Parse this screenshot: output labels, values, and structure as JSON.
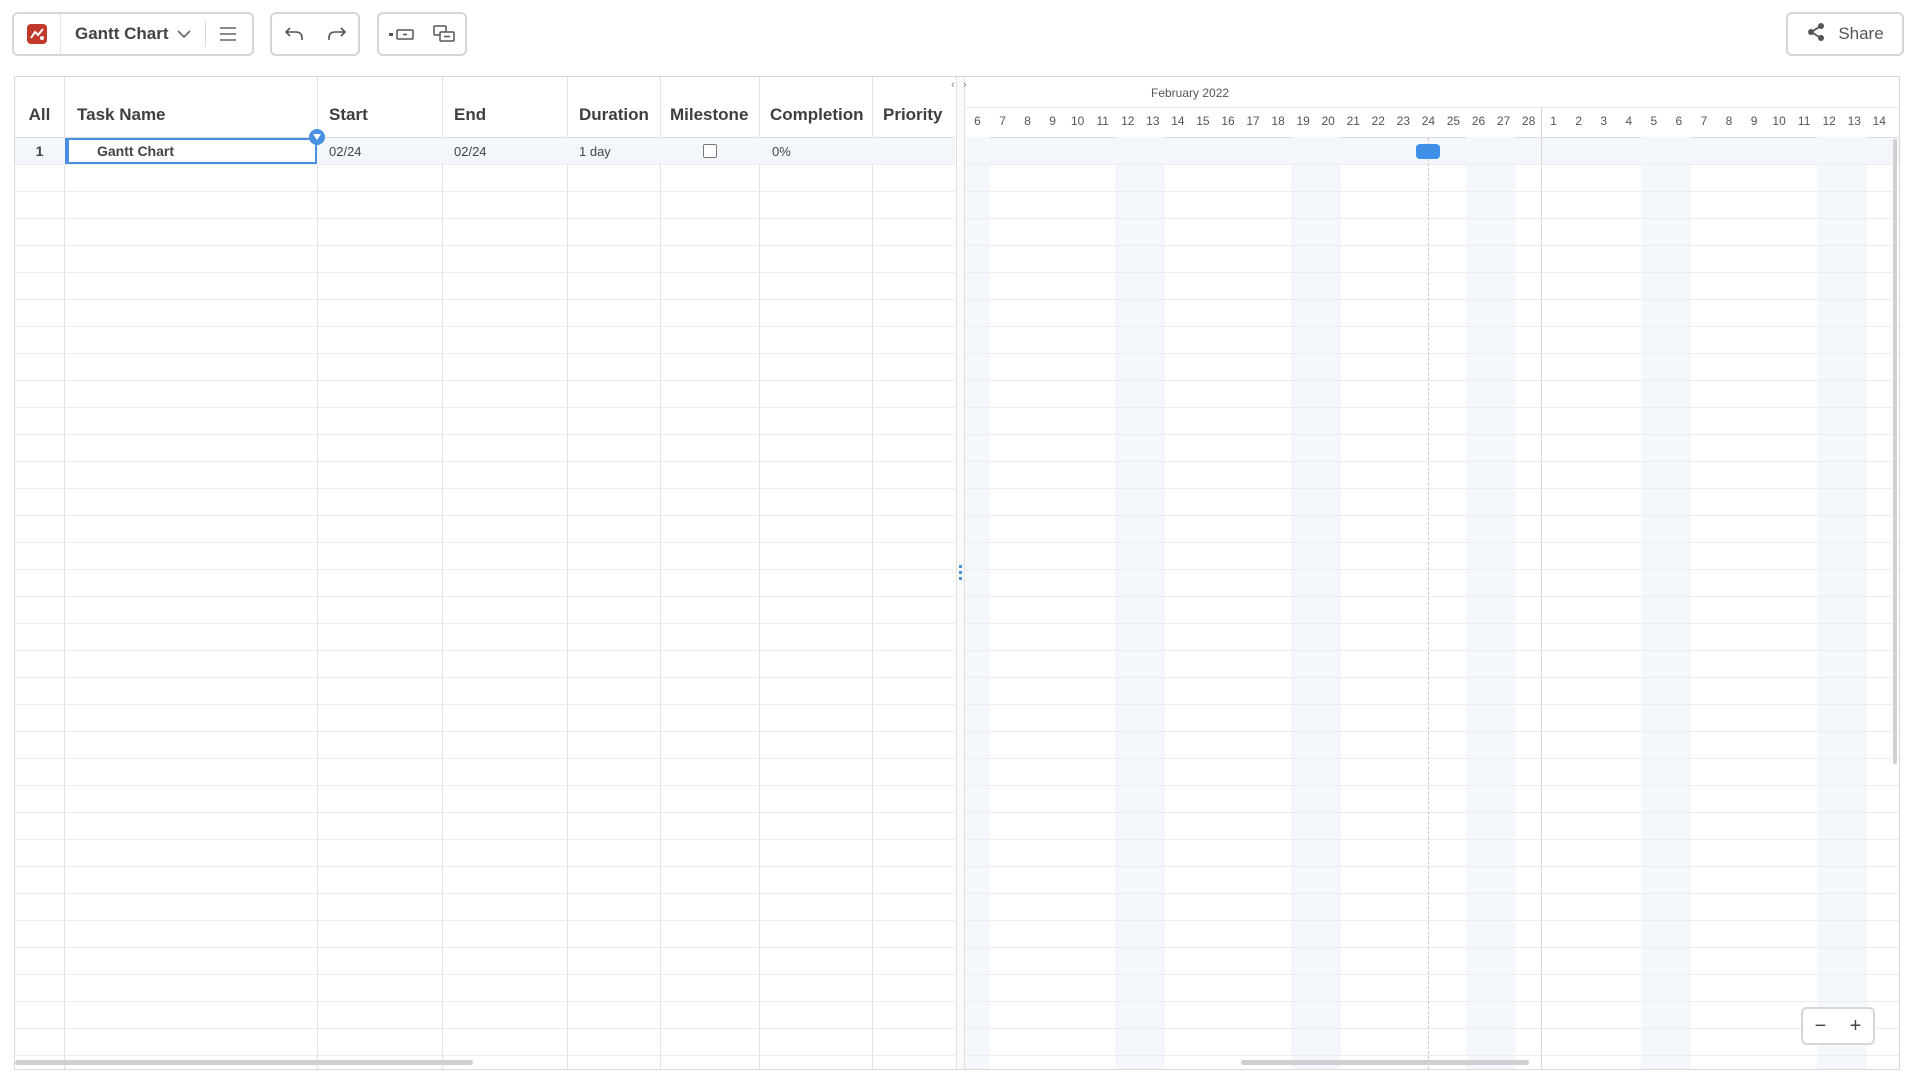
{
  "toolbar": {
    "doc_title": "Gantt Chart",
    "share_label": "Share"
  },
  "table": {
    "headers": [
      "All",
      "Task Name",
      "Start",
      "End",
      "Duration",
      "Milestone",
      "Completion",
      "Priority"
    ],
    "rows": [
      {
        "num": "1",
        "task": "Gantt Chart",
        "start": "02/24",
        "end": "02/24",
        "duration": "1 day",
        "milestone": false,
        "completion": "0%",
        "priority": ""
      }
    ]
  },
  "timeline": {
    "month_label": "February 2022",
    "days": [
      "6",
      "7",
      "8",
      "9",
      "10",
      "11",
      "12",
      "13",
      "14",
      "15",
      "16",
      "17",
      "18",
      "19",
      "20",
      "21",
      "22",
      "23",
      "24",
      "25",
      "26",
      "27",
      "28",
      "1",
      "2",
      "3",
      "4",
      "5",
      "6",
      "7",
      "8",
      "9",
      "10",
      "11",
      "12",
      "13",
      "14"
    ],
    "today_day": "24",
    "task_bar_day": "24"
  },
  "zoom": {
    "minus": "−",
    "plus": "+"
  },
  "colors": {
    "accent": "#4a90e2",
    "logo": "#c0392b",
    "bar": "#3d8fe8"
  }
}
